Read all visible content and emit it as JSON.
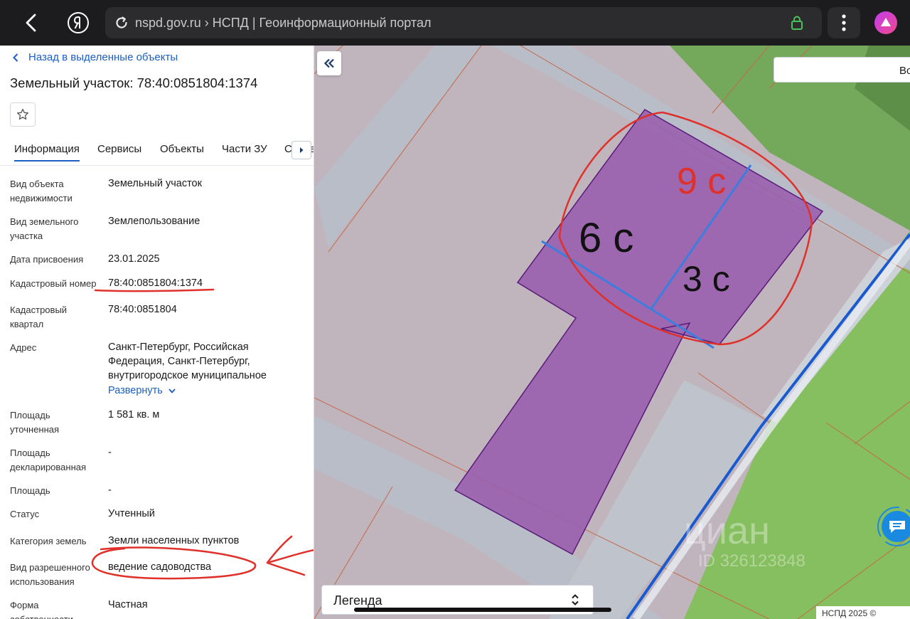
{
  "browser": {
    "url_text": "nspd.gov.ru › НСПД | Геоинформационный портал",
    "icons": [
      "back-arrow-icon",
      "yandex-logo-icon",
      "reload-icon",
      "lock-icon",
      "more-vertical-icon",
      "alice-icon"
    ]
  },
  "panel": {
    "back_link": "Назад в выделенные объекты",
    "title": "Земельный участок: 78:40:0851804:1374",
    "tabs": [
      "Информация",
      "Сервисы",
      "Объекты",
      "Части ЗУ",
      "Сведения"
    ],
    "rows": [
      {
        "label": "Вид объекта недвижимости",
        "value": "Земельный участок"
      },
      {
        "label": "Вид земельного участка",
        "value": "Землепользование"
      },
      {
        "label": "Дата присвоения",
        "value": "23.01.2025"
      },
      {
        "label": "Кадастровый номер",
        "value": "78:40:0851804:1374"
      },
      {
        "label": "Кадастровый квартал",
        "value": "78:40:0851804"
      },
      {
        "label": "Адрес",
        "value": "Санкт-Петербург, Российская Федерация, Санкт-Петербург, внутригородское муниципальное"
      },
      {
        "label": "Площадь уточненная",
        "value": "1 581 кв. м"
      },
      {
        "label": "Площадь декларированная",
        "value": "-"
      },
      {
        "label": "Площадь",
        "value": "-"
      },
      {
        "label": "Статус",
        "value": "Учтенный"
      },
      {
        "label": "Категория земель",
        "value": "Земли населенных пунктов"
      },
      {
        "label": "Вид разрешенного использования",
        "value": "ведение садоводства"
      },
      {
        "label": "Форма собственности",
        "value": "Частная"
      }
    ],
    "expand_link": "Развернуть"
  },
  "map": {
    "search_text": "Во",
    "legend_label": "Легенда",
    "copyright": "НСПД 2025 ©",
    "annotations": [
      "9 с",
      "6 с",
      "3 с"
    ],
    "watermark_brand": "циан",
    "watermark_id": "ID 326123848",
    "colors": {
      "parcel": "#9a5fae",
      "parcel_border": "#5a1a7a",
      "highlight": "#e0302a",
      "split_line": "#3a7ee0",
      "grass": "#7cba5a"
    }
  }
}
